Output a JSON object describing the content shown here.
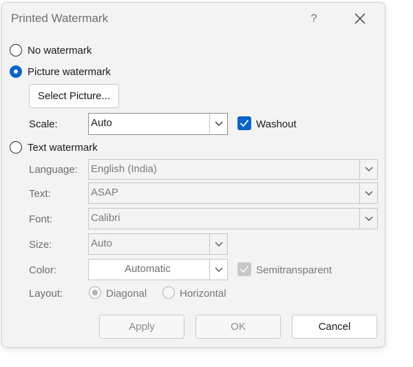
{
  "dialog": {
    "title": "Printed Watermark",
    "help_label": "?",
    "options": {
      "no_watermark": "No watermark",
      "picture_watermark": "Picture watermark",
      "text_watermark": "Text watermark",
      "selected": "picture_watermark"
    },
    "picture": {
      "select_button": "Select Picture...",
      "scale_label": "Scale:",
      "scale_value": "Auto",
      "washout_label": "Washout",
      "washout_checked": true
    },
    "text": {
      "language_label": "Language:",
      "language_value": "English (India)",
      "text_label": "Text:",
      "text_value": "ASAP",
      "font_label": "Font:",
      "font_value": "Calibri",
      "size_label": "Size:",
      "size_value": "Auto",
      "color_label": "Color:",
      "color_value": "Automatic",
      "semitransparent_label": "Semitransparent",
      "semitransparent_checked": true,
      "layout_label": "Layout:",
      "layout_diagonal": "Diagonal",
      "layout_horizontal": "Horizontal",
      "layout_selected": "diagonal"
    },
    "buttons": {
      "apply": "Apply",
      "ok": "OK",
      "cancel": "Cancel"
    }
  },
  "colors": {
    "accent": "#0a63c9",
    "dialog_bg": "#f3f3f3",
    "disabled_text": "#777777"
  },
  "icons": {
    "close": "close-icon",
    "help": "help-icon",
    "dropdown": "chevron-down-icon",
    "check": "check-icon"
  }
}
